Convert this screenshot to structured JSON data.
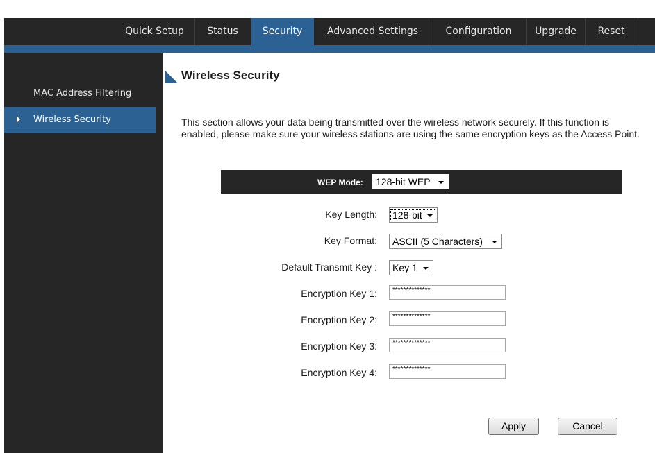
{
  "nav": {
    "items": [
      {
        "label": "Quick Setup"
      },
      {
        "label": "Status"
      },
      {
        "label": "Security"
      },
      {
        "label": "Advanced Settings"
      },
      {
        "label": "Configuration"
      },
      {
        "label": "Upgrade"
      },
      {
        "label": "Reset"
      }
    ],
    "active": "Security"
  },
  "sidebar": {
    "items": [
      {
        "label": "MAC Address Filtering"
      },
      {
        "label": "Wireless Security"
      }
    ],
    "active": "Wireless Security"
  },
  "page": {
    "title": "Wireless Security",
    "description": "This section allows your data being transmitted over the wireless network securely. If this function is enabled, please make sure your wireless stations are using the same encryption keys as the Access Point."
  },
  "form": {
    "wep_mode_label": "WEP Mode:",
    "wep_mode_value": "128-bit WEP",
    "key_length_label": "Key Length:",
    "key_length_value": "128-bit",
    "key_format_label": "Key Format:",
    "key_format_value": "ASCII (5 Characters)",
    "default_key_label": "Default Transmit Key :",
    "default_key_value": "Key 1",
    "keys": [
      {
        "label": "Encryption Key 1:",
        "value": "**************"
      },
      {
        "label": "Encryption Key 2:",
        "value": "**************"
      },
      {
        "label": "Encryption Key 3:",
        "value": "**************"
      },
      {
        "label": "Encryption Key 4:",
        "value": "**************"
      }
    ]
  },
  "buttons": {
    "apply": "Apply",
    "cancel": "Cancel"
  },
  "colors": {
    "accent": "#2b6193",
    "dark": "#262626"
  },
  "icons": [
    "chevron-down-icon",
    "chevron-right-icon",
    "title-triangle-icon",
    "dropdown-caret-icon"
  ]
}
